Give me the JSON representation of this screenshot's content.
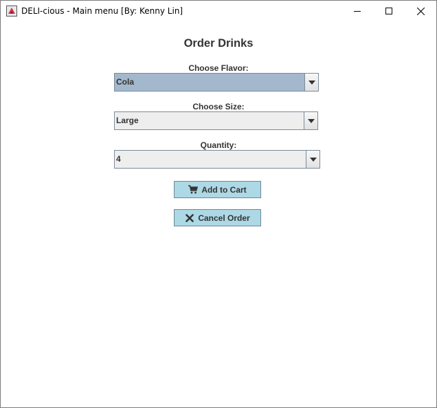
{
  "window": {
    "title": "DELI-cious - Main menu [By: Kenny Lin]",
    "controls": {
      "minimize_icon": "minimize-icon",
      "maximize_icon": "maximize-icon",
      "close_icon": "close-icon"
    }
  },
  "main": {
    "heading": "Order Drinks",
    "flavor": {
      "label": "Choose Flavor:",
      "value": "Cola"
    },
    "size": {
      "label": "Choose Size:",
      "value": "Large"
    },
    "quantity": {
      "label": "Quantity:",
      "value": "4"
    },
    "add_button": {
      "label": "Add to Cart",
      "icon": "cart-icon"
    },
    "cancel_button": {
      "label": "Cancel Order",
      "icon": "x-icon"
    }
  },
  "colors": {
    "button_bg": "#add8e6",
    "selected_combo_bg": "#a3b8cc",
    "text": "#333333"
  }
}
